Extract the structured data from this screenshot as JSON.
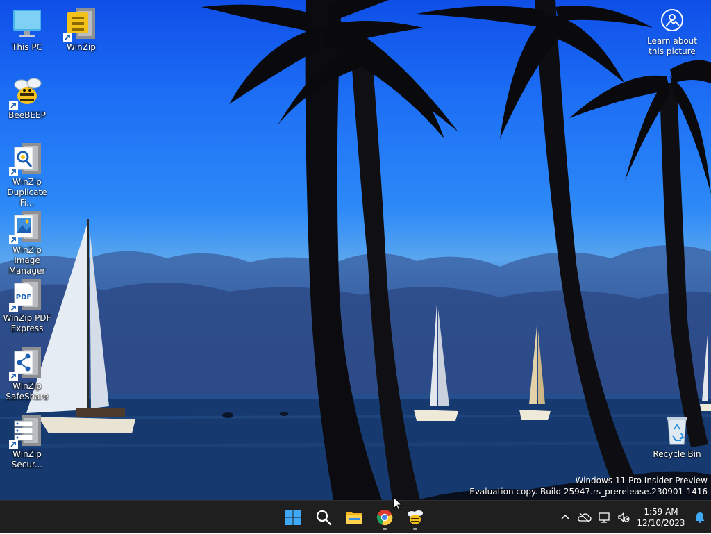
{
  "desktop": {
    "icons": [
      {
        "label": "This PC",
        "icon": "this-pc-icon"
      },
      {
        "label": "WinZip",
        "icon": "winzip-icon"
      },
      {
        "label": "BeeBEEP",
        "icon": "beebeep-icon"
      },
      {
        "label": "WinZip\nDuplicate Fi...",
        "icon": "winzip-duplicate-finder-icon"
      },
      {
        "label": "WinZip Image\nManager",
        "icon": "winzip-image-manager-icon"
      },
      {
        "label": "WinZip PDF\nExpress",
        "icon": "winzip-pdf-express-icon"
      },
      {
        "label": "WinZip\nSafeShare",
        "icon": "winzip-safeshare-icon"
      },
      {
        "label": "WinZip\nSecur...",
        "icon": "winzip-secure-backup-icon"
      },
      {
        "label": "Recycle Bin",
        "icon": "recycle-bin-icon"
      }
    ],
    "learn_about": "Learn about\nthis picture",
    "watermark": {
      "line1": "Windows 11 Pro Insider Preview",
      "line2": "Evaluation copy. Build 25947.rs_prerelease.230901-1416"
    }
  },
  "taskbar": {
    "apps": [
      {
        "icon": "start-windows-icon",
        "running": false
      },
      {
        "icon": "search-icon",
        "running": false
      },
      {
        "icon": "file-explorer-icon",
        "running": false
      },
      {
        "icon": "chrome-icon",
        "running": true
      },
      {
        "icon": "beebeep-icon",
        "running": true
      }
    ],
    "tray": [
      "chevron-up-icon",
      "onedrive-offline-icon",
      "network-icon",
      "volume-muted-icon"
    ],
    "clock": {
      "time": "1:59 AM",
      "date": "12/10/2023"
    }
  },
  "colors": {
    "taskbar": "#1f1f1f",
    "pdf_blue": "#1a5fb4",
    "winzip_gray": "#8d8f93"
  }
}
